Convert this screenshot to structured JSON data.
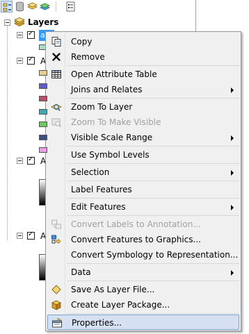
{
  "toc": {
    "layers_title": "Layers",
    "selected_layer_label": "a",
    "layer_labels": [
      "A",
      "A",
      "A"
    ],
    "swatch_colors": [
      "#e6cf8a",
      "#5d5dc4",
      "#b94d6a",
      "#3fa9b5",
      "#6acb5f",
      "#3b4f86",
      "#ee9de8"
    ],
    "first_swatch_color": "#a6e0c2"
  },
  "menu": {
    "items": [
      {
        "label": "Copy",
        "icon": "copy-icon",
        "enabled": true,
        "submenu": false
      },
      {
        "label": "Remove",
        "icon": "remove-icon",
        "enabled": true,
        "submenu": false
      },
      {
        "label": "Open Attribute Table",
        "icon": "table-icon",
        "enabled": true,
        "submenu": false
      },
      {
        "label": "Joins and Relates",
        "icon": "",
        "enabled": true,
        "submenu": true
      },
      {
        "label": "Zoom To Layer",
        "icon": "zoom-to-layer-icon",
        "enabled": true,
        "submenu": false
      },
      {
        "label": "Zoom To Make Visible",
        "icon": "zoom-visible-icon",
        "enabled": false,
        "submenu": false
      },
      {
        "label": "Visible Scale Range",
        "icon": "",
        "enabled": true,
        "submenu": true
      },
      {
        "label": "Use Symbol Levels",
        "icon": "",
        "enabled": true,
        "submenu": false
      },
      {
        "label": "Selection",
        "icon": "",
        "enabled": true,
        "submenu": true
      },
      {
        "label": "Label Features",
        "icon": "",
        "enabled": true,
        "submenu": false
      },
      {
        "label": "Edit Features",
        "icon": "",
        "enabled": true,
        "submenu": true
      },
      {
        "label": "Convert Labels to Annotation...",
        "icon": "convert-labels-icon",
        "enabled": false,
        "submenu": false
      },
      {
        "label": "Convert Features to Graphics...",
        "icon": "convert-graphics-icon",
        "enabled": true,
        "submenu": false
      },
      {
        "label": "Convert Symbology to Representation...",
        "icon": "",
        "enabled": true,
        "submenu": false
      },
      {
        "label": "Data",
        "icon": "",
        "enabled": true,
        "submenu": true
      },
      {
        "label": "Save As Layer File...",
        "icon": "save-layer-icon",
        "enabled": true,
        "submenu": false
      },
      {
        "label": "Create Layer Package...",
        "icon": "layer-package-icon",
        "enabled": true,
        "submenu": false
      },
      {
        "label": "Properties...",
        "icon": "properties-icon",
        "enabled": true,
        "submenu": false,
        "highlighted": true
      }
    ]
  },
  "colors": {
    "menu_background": "#f0f0f0",
    "highlight_background": "#d5e1f2",
    "highlight_border": "#7da2ce",
    "selection_blue": "#3399ff",
    "disabled_text": "#a0a0a0"
  }
}
